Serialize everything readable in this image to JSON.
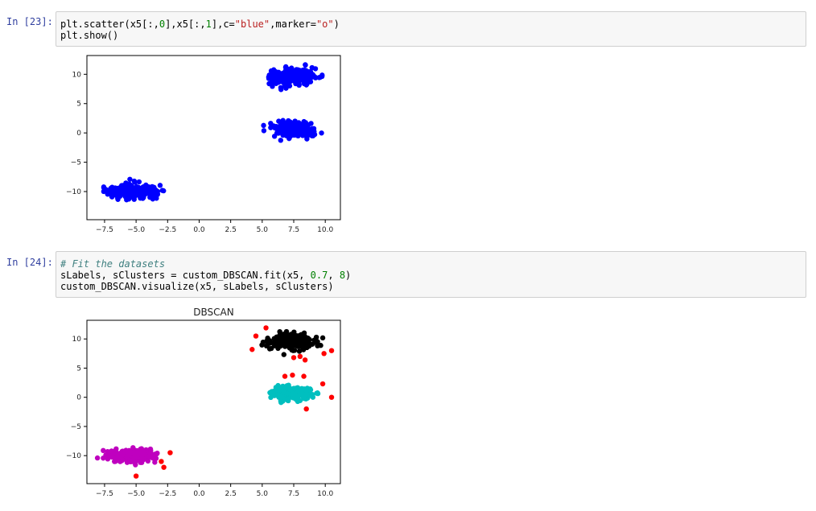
{
  "cells": [
    {
      "prompt": "In [23]:",
      "code_lines": [
        [
          "plt.scatter(x5[:,",
          {
            "t": "num",
            "v": "0"
          },
          "],x5[:,",
          {
            "t": "num",
            "v": "1"
          },
          "],c=",
          {
            "t": "str",
            "v": "\"blue\""
          },
          ",marker=",
          {
            "t": "str",
            "v": "\"o\""
          },
          ")"
        ],
        [
          "plt.show()"
        ]
      ]
    },
    {
      "prompt": "In [24]:",
      "code_lines": [
        [
          {
            "t": "comment",
            "v": "# Fit the datasets"
          }
        ],
        [
          "sLabels, sClusters = custom_DBSCAN.fit(x5, ",
          {
            "t": "num",
            "v": "0.7"
          },
          ", ",
          {
            "t": "num",
            "v": "8"
          },
          ")"
        ],
        [
          "custom_DBSCAN.visualize(x5, sLabels, sClusters)"
        ]
      ]
    }
  ],
  "chart_data": [
    {
      "type": "scatter",
      "title": "",
      "xlim": [
        -8.9,
        11.2
      ],
      "ylim": [
        -14.8,
        13.2
      ],
      "xticks": [
        -7.5,
        -5.0,
        -2.5,
        0.0,
        2.5,
        5.0,
        7.5,
        10.0
      ],
      "xtick_labels": [
        "−7.5",
        "−5.0",
        "−2.5",
        "0.0",
        "2.5",
        "5.0",
        "7.5",
        "10.0"
      ],
      "yticks": [
        10,
        5,
        0,
        -5,
        -10
      ],
      "ytick_labels": [
        "10",
        "5",
        "0",
        "−5",
        "−10"
      ],
      "grid": false,
      "series": [
        {
          "color": "#0000ff",
          "clusters": [
            {
              "cx": -5.3,
              "cy": -10.0,
              "sx": 1.7,
              "sy": 1.0,
              "n": 260
            },
            {
              "cx": 7.4,
              "cy": 9.6,
              "sx": 1.6,
              "sy": 1.2,
              "n": 260
            },
            {
              "cx": 7.4,
              "cy": 0.6,
              "sx": 1.5,
              "sy": 1.0,
              "n": 260
            }
          ]
        }
      ]
    },
    {
      "type": "scatter",
      "title": "DBSCAN",
      "xlim": [
        -8.9,
        11.2
      ],
      "ylim": [
        -14.8,
        13.2
      ],
      "xticks": [
        -7.5,
        -5.0,
        -2.5,
        0.0,
        2.5,
        5.0,
        7.5,
        10.0
      ],
      "xtick_labels": [
        "−7.5",
        "−5.0",
        "−2.5",
        "0.0",
        "2.5",
        "5.0",
        "7.5",
        "10.0"
      ],
      "yticks": [
        10,
        5,
        0,
        -5,
        -10
      ],
      "ytick_labels": [
        "10",
        "5",
        "0",
        "−5",
        "−10"
      ],
      "grid": false,
      "series": [
        {
          "color": "#bf00bf",
          "clusters": [
            {
              "cx": -5.3,
              "cy": -10.0,
              "sx": 1.6,
              "sy": 0.95,
              "n": 260
            }
          ]
        },
        {
          "color": "#000000",
          "clusters": [
            {
              "cx": 7.4,
              "cy": 9.6,
              "sx": 1.5,
              "sy": 1.1,
              "n": 260
            }
          ]
        },
        {
          "color": "#00bfbf",
          "clusters": [
            {
              "cx": 7.4,
              "cy": 0.6,
              "sx": 1.4,
              "sy": 0.9,
              "n": 260
            }
          ]
        },
        {
          "color": "#ff0000",
          "points": [
            [
              -5.0,
              -13.5
            ],
            [
              -2.3,
              -9.5
            ],
            [
              -2.8,
              -12.0
            ],
            [
              -3.0,
              -11.0
            ],
            [
              4.2,
              8.2
            ],
            [
              4.5,
              10.5
            ],
            [
              5.3,
              11.9
            ],
            [
              10.5,
              8.0
            ],
            [
              9.9,
              7.5
            ],
            [
              7.5,
              6.8
            ],
            [
              8.4,
              6.4
            ],
            [
              8.0,
              7.0
            ],
            [
              6.8,
              3.6
            ],
            [
              7.4,
              3.8
            ],
            [
              8.3,
              3.6
            ],
            [
              9.8,
              2.3
            ],
            [
              10.5,
              0.0
            ],
            [
              8.5,
              -2.0
            ]
          ]
        }
      ]
    }
  ]
}
